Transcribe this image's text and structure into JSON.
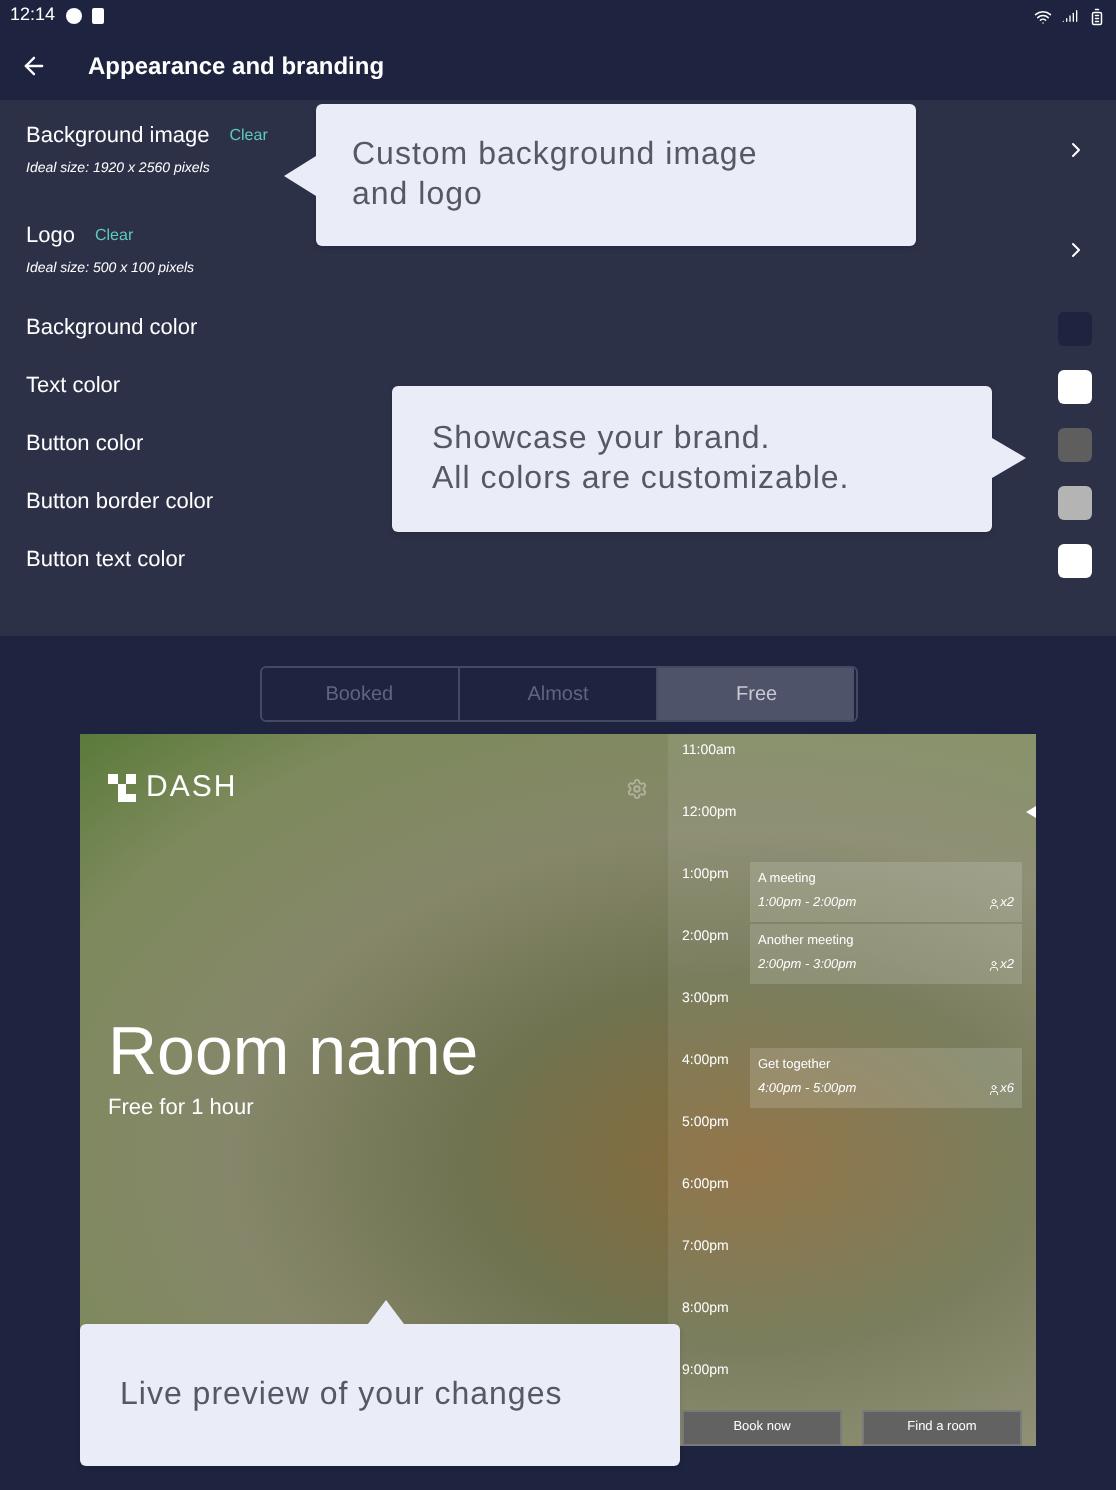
{
  "status_bar": {
    "time": "12:14"
  },
  "header": {
    "title": "Appearance and branding"
  },
  "settings": {
    "rows": [
      {
        "kind": "image",
        "label": "Background image",
        "action": "Clear",
        "hint": "Ideal size: 1920 x 2560 pixels"
      },
      {
        "kind": "image",
        "label": "Logo",
        "action": "Clear",
        "hint": "Ideal size: 500 x 100 pixels"
      },
      {
        "kind": "color",
        "label": "Background color",
        "color": "#1e2340"
      },
      {
        "kind": "color",
        "label": "Text color",
        "color": "#ffffff"
      },
      {
        "kind": "color",
        "label": "Button color",
        "color": "#5e5e5e"
      },
      {
        "kind": "color",
        "label": "Button border color",
        "color": "#b4b4b4"
      },
      {
        "kind": "color",
        "label": "Button text color",
        "color": "#ffffff"
      }
    ]
  },
  "preview": {
    "tabs": [
      {
        "label": "Booked",
        "selected": false
      },
      {
        "label": "Almost",
        "selected": false
      },
      {
        "label": "Free",
        "selected": true
      }
    ],
    "logo_text": "DASH",
    "room_name": "Room name",
    "room_status": "Free for 1 hour",
    "schedule": [
      {
        "time": "11:00am",
        "now": false
      },
      {
        "time": "12:00pm",
        "now": true
      },
      {
        "time": "1:00pm",
        "now": false,
        "event": {
          "title": "A meeting",
          "time": "1:00pm - 2:00pm",
          "attendees": "x2"
        }
      },
      {
        "time": "2:00pm",
        "now": false,
        "event": {
          "title": "Another meeting",
          "time": "2:00pm - 3:00pm",
          "attendees": "x2"
        }
      },
      {
        "time": "3:00pm",
        "now": false
      },
      {
        "time": "4:00pm",
        "now": false,
        "event": {
          "title": "Get together",
          "time": "4:00pm - 5:00pm",
          "attendees": "x6"
        }
      },
      {
        "time": "5:00pm",
        "now": false
      },
      {
        "time": "6:00pm",
        "now": false
      },
      {
        "time": "7:00pm",
        "now": false
      },
      {
        "time": "8:00pm",
        "now": false
      },
      {
        "time": "9:00pm",
        "now": false
      }
    ],
    "buttons": [
      "Book now",
      "Find a room"
    ]
  },
  "callouts": {
    "image": "Custom background image and logo",
    "colors": [
      "Showcase your brand.",
      "All colors are customizable."
    ],
    "preview": "Live preview of your changes"
  }
}
